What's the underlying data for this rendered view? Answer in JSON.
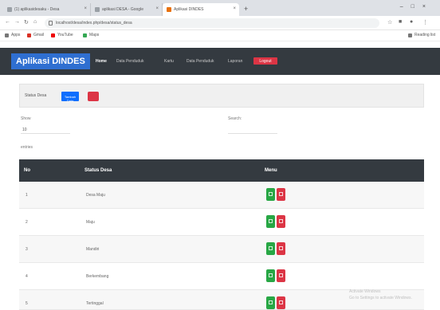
{
  "browser": {
    "tabs": [
      {
        "label": "(1) aplikasidesaku - Desa"
      },
      {
        "label": "aplikasi DESA - Google"
      },
      {
        "label": "Aplikasi DINDES"
      }
    ],
    "url": "localhost/desa/index.php/desa/status_desa",
    "bookmarks": [
      {
        "label": "Apps"
      },
      {
        "label": "Gmail"
      },
      {
        "label": "YouTube"
      },
      {
        "label": "Maps"
      }
    ],
    "reading_list": "Reading list"
  },
  "navbar": {
    "brand": "Aplikasi DINDES",
    "links": [
      "Home",
      "Data Penduduk",
      "Kartu",
      "Data Penduduk",
      "Laporan"
    ],
    "logout": "Logout"
  },
  "card": {
    "title": "Status Desa",
    "add_button": "Tambah Data"
  },
  "controls": {
    "show_label": "Show",
    "show_value": "10",
    "entries_label": "entries",
    "search_label": "Search:"
  },
  "table": {
    "headers": [
      "No",
      "Status Desa",
      "Menu"
    ],
    "rows": [
      {
        "no": "1",
        "status": "Desa Maju"
      },
      {
        "no": "2",
        "status": "Maju"
      },
      {
        "no": "3",
        "status": "Mandiri"
      },
      {
        "no": "4",
        "status": "Berkembang"
      },
      {
        "no": "5",
        "status": "Tertinggal"
      }
    ]
  },
  "watermark": {
    "line1": "Activate Windows",
    "line2": "Go to Settings to activate Windows."
  },
  "colors": {
    "navbar": "#343a40",
    "brand": "#2f6fd1",
    "primary": "#0d6efd",
    "danger": "#dc3545",
    "success": "#28a745"
  }
}
